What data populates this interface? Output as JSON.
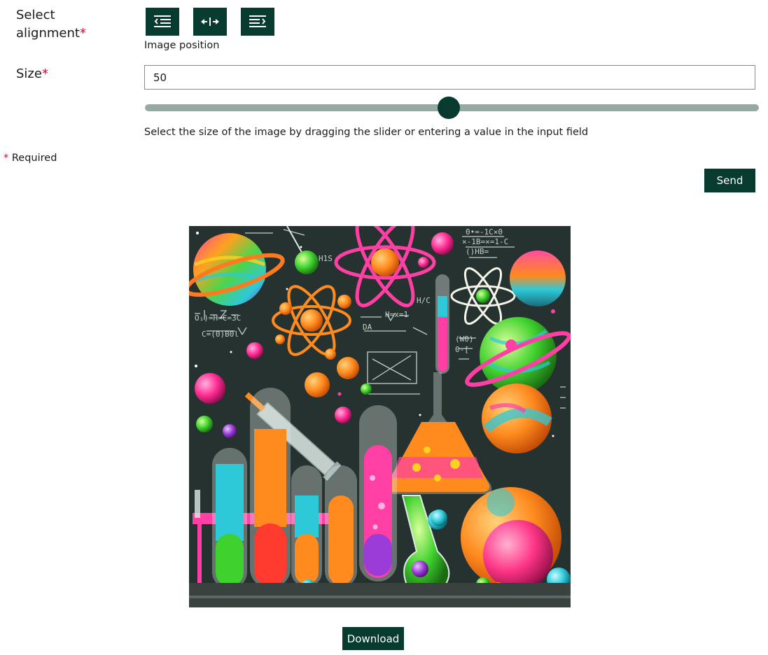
{
  "alignment": {
    "label_line1": "Select",
    "label_line2": "alignment",
    "required_mark": "*",
    "buttons": [
      {
        "icon": "align-left-icon",
        "aria": "Align left"
      },
      {
        "icon": "align-center-icon",
        "aria": "Align center"
      },
      {
        "icon": "align-right-icon",
        "aria": "Align right"
      }
    ],
    "hint": "Image position"
  },
  "size": {
    "label": "Size",
    "required_mark": "*",
    "value": "50",
    "slider_value_percent": 50,
    "hint": "Select the size of the image by dragging the slider or entering a value in the input field"
  },
  "required_note": {
    "mark": "*",
    "text": "Required"
  },
  "actions": {
    "send_label": "Send",
    "download_label": "Download"
  },
  "image": {
    "description": "colorful-science-lab-illustration"
  },
  "colors": {
    "primary": "#073b30",
    "track": "#97a9a3",
    "required": "#c8102e"
  }
}
